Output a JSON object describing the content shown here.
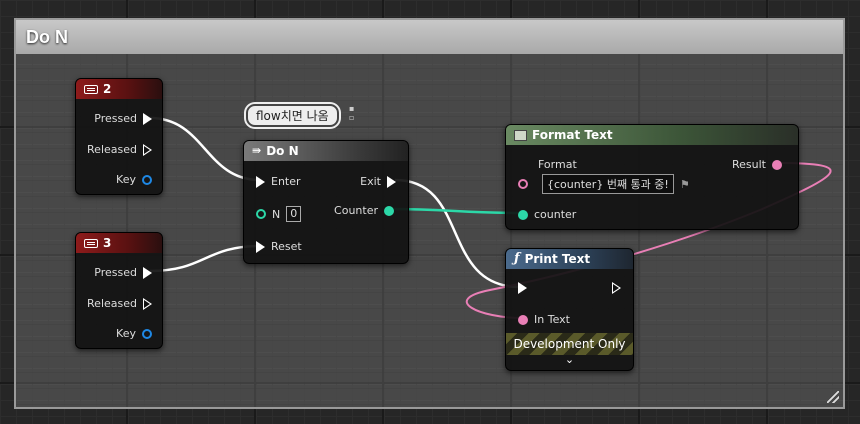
{
  "comment": {
    "title": "Do N"
  },
  "key2": {
    "title": "2",
    "pins": {
      "pressed": "Pressed",
      "released": "Released",
      "key": "Key"
    }
  },
  "key3": {
    "title": "3",
    "pins": {
      "pressed": "Pressed",
      "released": "Released",
      "key": "Key"
    }
  },
  "don": {
    "title": "Do N",
    "comment_bubble": "flow치면 나옴",
    "pins": {
      "enter": "Enter",
      "n": "N",
      "n_value": "0",
      "reset": "Reset",
      "exit": "Exit",
      "counter": "Counter"
    }
  },
  "format_text": {
    "title": "Format Text",
    "pins": {
      "format": "Format",
      "format_value": "{counter} 번째 통과 중!",
      "counter": "counter",
      "result": "Result"
    }
  },
  "print_text": {
    "title": "Print Text",
    "pins": {
      "in_text": "In Text"
    },
    "dev_only": "Development Only",
    "expand_glyph": "⌄"
  },
  "colors": {
    "exec": "#ffffff",
    "integer": "#2cd8a8",
    "text": "#e97fb6",
    "key": "#1e88e5",
    "input_event": "#8e1b1b"
  }
}
